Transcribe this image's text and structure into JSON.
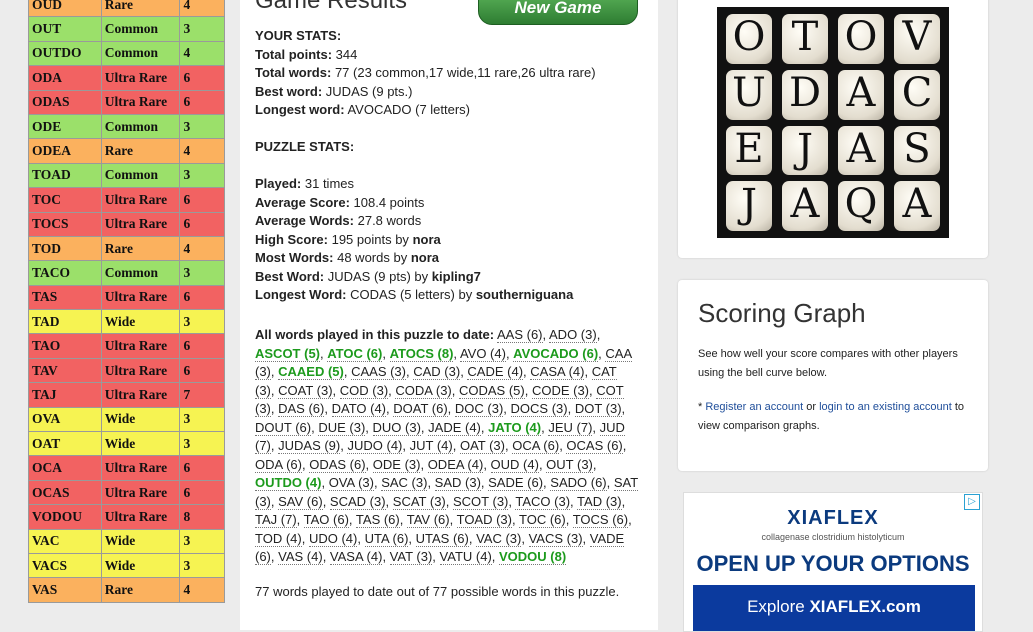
{
  "word_table": [
    {
      "word": "OUD",
      "type": "Rare",
      "points": "4",
      "cls": "rare"
    },
    {
      "word": "OUT",
      "type": "Common",
      "points": "3",
      "cls": "common"
    },
    {
      "word": "OUTDO",
      "type": "Common",
      "points": "4",
      "cls": "common"
    },
    {
      "word": "ODA",
      "type": "Ultra Rare",
      "points": "6",
      "cls": "ultra"
    },
    {
      "word": "ODAS",
      "type": "Ultra Rare",
      "points": "6",
      "cls": "ultra"
    },
    {
      "word": "ODE",
      "type": "Common",
      "points": "3",
      "cls": "common"
    },
    {
      "word": "ODEA",
      "type": "Rare",
      "points": "4",
      "cls": "rare"
    },
    {
      "word": "TOAD",
      "type": "Common",
      "points": "3",
      "cls": "common"
    },
    {
      "word": "TOC",
      "type": "Ultra Rare",
      "points": "6",
      "cls": "ultra"
    },
    {
      "word": "TOCS",
      "type": "Ultra Rare",
      "points": "6",
      "cls": "ultra"
    },
    {
      "word": "TOD",
      "type": "Rare",
      "points": "4",
      "cls": "rare"
    },
    {
      "word": "TACO",
      "type": "Common",
      "points": "3",
      "cls": "common"
    },
    {
      "word": "TAS",
      "type": "Ultra Rare",
      "points": "6",
      "cls": "ultra"
    },
    {
      "word": "TAD",
      "type": "Wide",
      "points": "3",
      "cls": "wide"
    },
    {
      "word": "TAO",
      "type": "Ultra Rare",
      "points": "6",
      "cls": "ultra"
    },
    {
      "word": "TAV",
      "type": "Ultra Rare",
      "points": "6",
      "cls": "ultra"
    },
    {
      "word": "TAJ",
      "type": "Ultra Rare",
      "points": "7",
      "cls": "ultra"
    },
    {
      "word": "OVA",
      "type": "Wide",
      "points": "3",
      "cls": "wide"
    },
    {
      "word": "OAT",
      "type": "Wide",
      "points": "3",
      "cls": "wide"
    },
    {
      "word": "OCA",
      "type": "Ultra Rare",
      "points": "6",
      "cls": "ultra"
    },
    {
      "word": "OCAS",
      "type": "Ultra Rare",
      "points": "6",
      "cls": "ultra"
    },
    {
      "word": "VODOU",
      "type": "Ultra Rare",
      "points": "8",
      "cls": "ultra"
    },
    {
      "word": "VAC",
      "type": "Wide",
      "points": "3",
      "cls": "wide"
    },
    {
      "word": "VACS",
      "type": "Wide",
      "points": "3",
      "cls": "wide"
    },
    {
      "word": "VAS",
      "type": "Rare",
      "points": "4",
      "cls": "rare"
    }
  ],
  "results": {
    "title": "Game Results",
    "new_game": "New Game",
    "your_stats_heading": "YOUR STATS:",
    "total_points_label": "Total points:",
    "total_points": "344",
    "total_words_label": "Total words:",
    "total_words": "77 (23 common,17 wide,11 rare,26 ultra rare)",
    "best_word_label": "Best word:",
    "best_word": "JUDAS (9 pts.)",
    "longest_word_label": "Longest word:",
    "longest_word": "AVOCADO (7 letters)",
    "puzzle_stats_heading": "PUZZLE STATS:",
    "played_label": "Played:",
    "played": "31 times",
    "avg_score_label": "Average Score:",
    "avg_score": "108.4 points",
    "avg_words_label": "Average Words:",
    "avg_words": "27.8 words",
    "high_score_label": "High Score:",
    "high_score": "195 points by",
    "high_score_user": "nora",
    "most_words_label": "Most Words:",
    "most_words": "48 words by",
    "most_words_user": "nora",
    "best_word_p_label": "Best Word:",
    "best_word_p": "JUDAS (9 pts) by",
    "best_word_p_user": "kipling7",
    "longest_word_p_label": "Longest Word:",
    "longest_word_p": "CODAS (5 letters) by",
    "longest_word_p_user": "southerniguana",
    "all_words_label": "All words played in this puzzle to date:",
    "summary": "77 words played to date out of 77 possible words in this puzzle."
  },
  "all_words": [
    {
      "t": "AAS (6)",
      "f": false
    },
    {
      "t": "ADO (3)",
      "f": false
    },
    {
      "t": "ASCOT (5)",
      "f": true
    },
    {
      "t": "ATOC (6)",
      "f": true
    },
    {
      "t": "ATOCS (8)",
      "f": true
    },
    {
      "t": "AVO (4)",
      "f": false
    },
    {
      "t": "AVOCADO (6)",
      "f": true
    },
    {
      "t": "CAA (3)",
      "f": false
    },
    {
      "t": "CAAED (5)",
      "f": true
    },
    {
      "t": "CAAS (3)",
      "f": false
    },
    {
      "t": "CAD (3)",
      "f": false
    },
    {
      "t": "CADE (4)",
      "f": false
    },
    {
      "t": "CASA (4)",
      "f": false
    },
    {
      "t": "CAT (3)",
      "f": false
    },
    {
      "t": "COAT (3)",
      "f": false
    },
    {
      "t": "COD (3)",
      "f": false
    },
    {
      "t": "CODA (3)",
      "f": false
    },
    {
      "t": "CODAS (5)",
      "f": false
    },
    {
      "t": "CODE (3)",
      "f": false
    },
    {
      "t": "COT (3)",
      "f": false
    },
    {
      "t": "DAS (6)",
      "f": false
    },
    {
      "t": "DATO (4)",
      "f": false
    },
    {
      "t": "DOAT (6)",
      "f": false
    },
    {
      "t": "DOC (3)",
      "f": false
    },
    {
      "t": "DOCS (3)",
      "f": false
    },
    {
      "t": "DOT (3)",
      "f": false
    },
    {
      "t": "DOUT (6)",
      "f": false
    },
    {
      "t": "DUE (3)",
      "f": false
    },
    {
      "t": "DUO (3)",
      "f": false
    },
    {
      "t": "JADE (4)",
      "f": false
    },
    {
      "t": "JATO (4)",
      "f": true
    },
    {
      "t": "JEU (7)",
      "f": false
    },
    {
      "t": "JUD (7)",
      "f": false
    },
    {
      "t": "JUDAS (9)",
      "f": false
    },
    {
      "t": "JUDO (4)",
      "f": false
    },
    {
      "t": "JUT (4)",
      "f": false
    },
    {
      "t": "OAT (3)",
      "f": false
    },
    {
      "t": "OCA (6)",
      "f": false
    },
    {
      "t": "OCAS (6)",
      "f": false
    },
    {
      "t": "ODA (6)",
      "f": false
    },
    {
      "t": "ODAS (6)",
      "f": false
    },
    {
      "t": "ODE (3)",
      "f": false
    },
    {
      "t": "ODEA (4)",
      "f": false
    },
    {
      "t": "OUD (4)",
      "f": false
    },
    {
      "t": "OUT (3)",
      "f": false
    },
    {
      "t": "OUTDO (4)",
      "f": true
    },
    {
      "t": "OVA (3)",
      "f": false
    },
    {
      "t": "SAC (3)",
      "f": false
    },
    {
      "t": "SAD (3)",
      "f": false
    },
    {
      "t": "SADE (6)",
      "f": false
    },
    {
      "t": "SADO (6)",
      "f": false
    },
    {
      "t": "SAT (3)",
      "f": false
    },
    {
      "t": "SAV (6)",
      "f": false
    },
    {
      "t": "SCAD (3)",
      "f": false
    },
    {
      "t": "SCAT (3)",
      "f": false
    },
    {
      "t": "SCOT (3)",
      "f": false
    },
    {
      "t": "TACO (3)",
      "f": false
    },
    {
      "t": "TAD (3)",
      "f": false
    },
    {
      "t": "TAJ (7)",
      "f": false
    },
    {
      "t": "TAO (6)",
      "f": false
    },
    {
      "t": "TAS (6)",
      "f": false
    },
    {
      "t": "TAV (6)",
      "f": false
    },
    {
      "t": "TOAD (3)",
      "f": false
    },
    {
      "t": "TOC (6)",
      "f": false
    },
    {
      "t": "TOCS (6)",
      "f": false
    },
    {
      "t": "TOD (4)",
      "f": false
    },
    {
      "t": "UDO (4)",
      "f": false
    },
    {
      "t": "UTA (6)",
      "f": false
    },
    {
      "t": "UTAS (6)",
      "f": false
    },
    {
      "t": "VAC (3)",
      "f": false
    },
    {
      "t": "VACS (3)",
      "f": false
    },
    {
      "t": "VADE (6)",
      "f": false
    },
    {
      "t": "VAS (4)",
      "f": false
    },
    {
      "t": "VASA (4)",
      "f": false
    },
    {
      "t": "VAT (3)",
      "f": false
    },
    {
      "t": "VATU (4)",
      "f": false
    },
    {
      "t": "VODOU (8)",
      "f": true
    }
  ],
  "board": [
    "O",
    "T",
    "O",
    "V",
    "U",
    "D",
    "A",
    "C",
    "E",
    "J",
    "A",
    "S",
    "J",
    "A",
    "Q",
    "A"
  ],
  "graph": {
    "title": "Scoring Graph",
    "desc": "See how well your score compares with other players using the bell curve below.",
    "register": "Register an account",
    "or": "or",
    "login": "login to an existing account",
    "to_view": "to view comparison graphs."
  },
  "ad": {
    "brand": "XIAFLEX",
    "sub": "collagenase clostridium histolyticum",
    "head": "OPEN UP YOUR OPTIONS",
    "explore": "Explore",
    "site": "XIAFLEX.com",
    "choice": "▷"
  },
  "colors": {
    "common": "#9be06a",
    "ultra": "#f26262",
    "rare": "#fbb15e",
    "wide": "#f6f352",
    "found": "#1c9a1c"
  }
}
